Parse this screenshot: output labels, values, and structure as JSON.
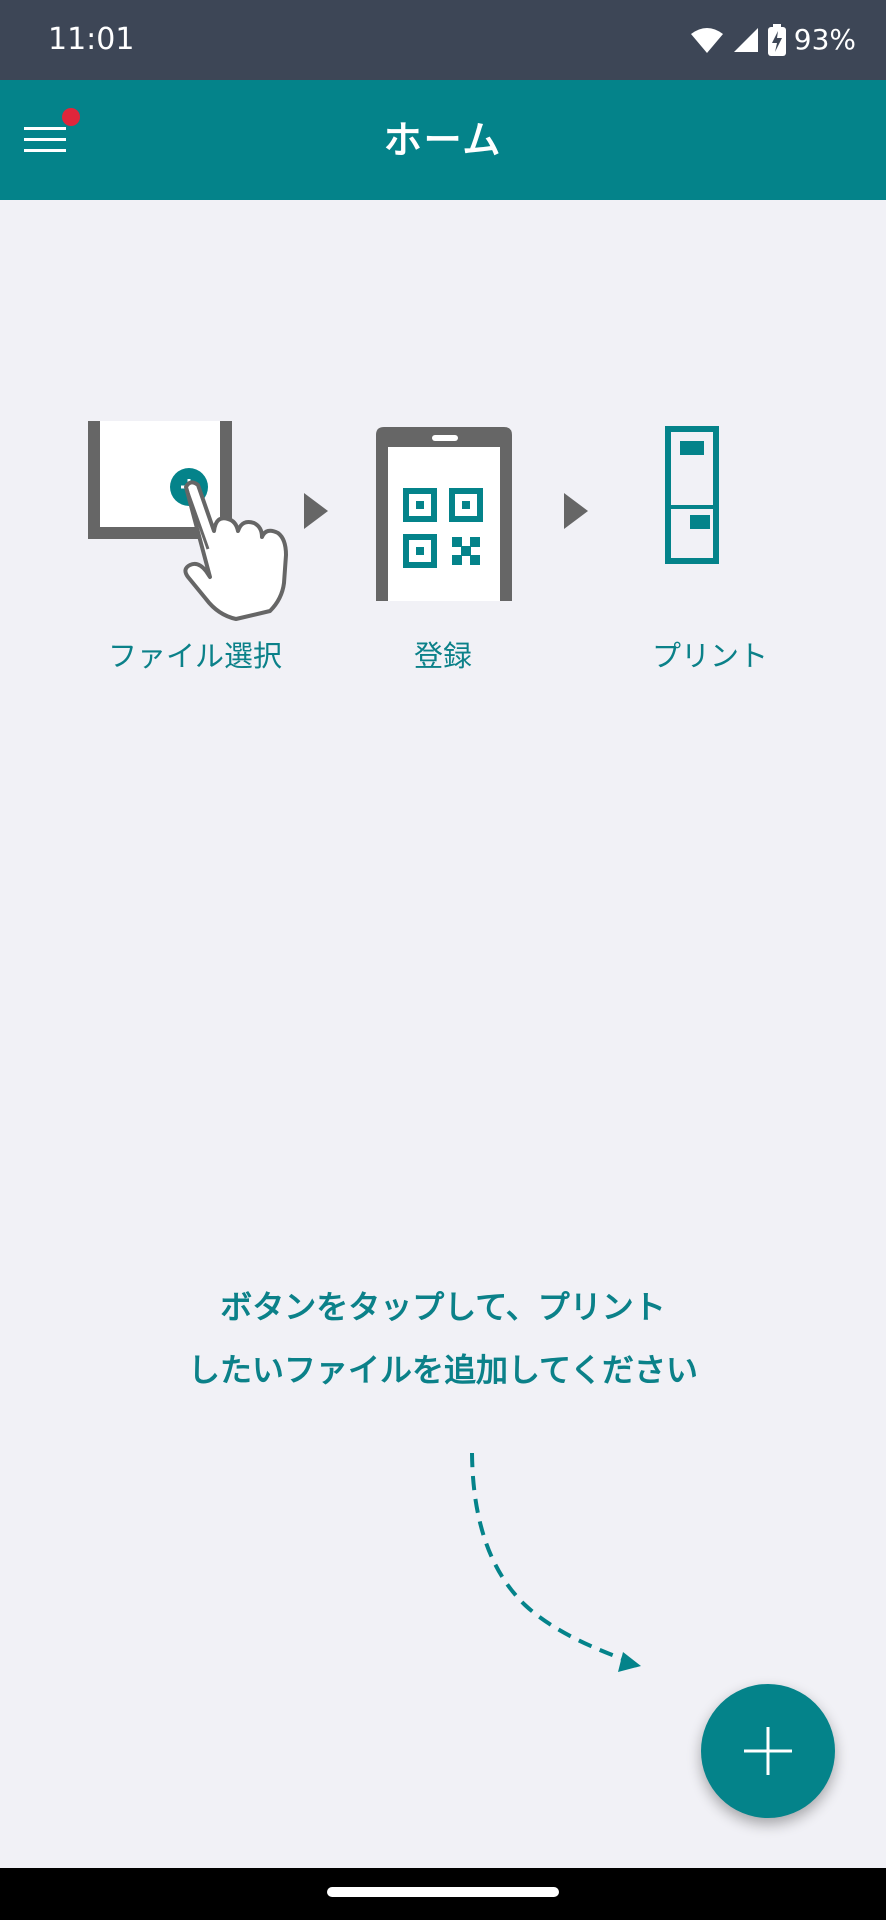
{
  "status_bar": {
    "time": "11:01",
    "battery_percent": "93%",
    "icons": [
      "wifi-icon",
      "cell-signal-icon",
      "battery-charging-icon"
    ]
  },
  "app_bar": {
    "title": "ホーム",
    "menu_icon": "hamburger-menu-icon",
    "has_notification_badge": true
  },
  "steps": [
    {
      "label": "ファイル選択",
      "icon": "tablet-tap-plus-icon"
    },
    {
      "label": "登録",
      "icon": "phone-qr-code-icon"
    },
    {
      "label": "プリント",
      "icon": "printer-phone-qr-icon"
    }
  ],
  "instruction": {
    "line1": "ボタンをタップして、プリント",
    "line2": "したいファイルを追加してください"
  },
  "fab": {
    "icon": "plus-icon"
  },
  "colors": {
    "accent": "#04838a",
    "accent_text": "#0b8189",
    "status_bar": "#3d4656",
    "background": "#f1f1f6",
    "badge": "#e0263b",
    "illustration_gray": "#666666"
  }
}
